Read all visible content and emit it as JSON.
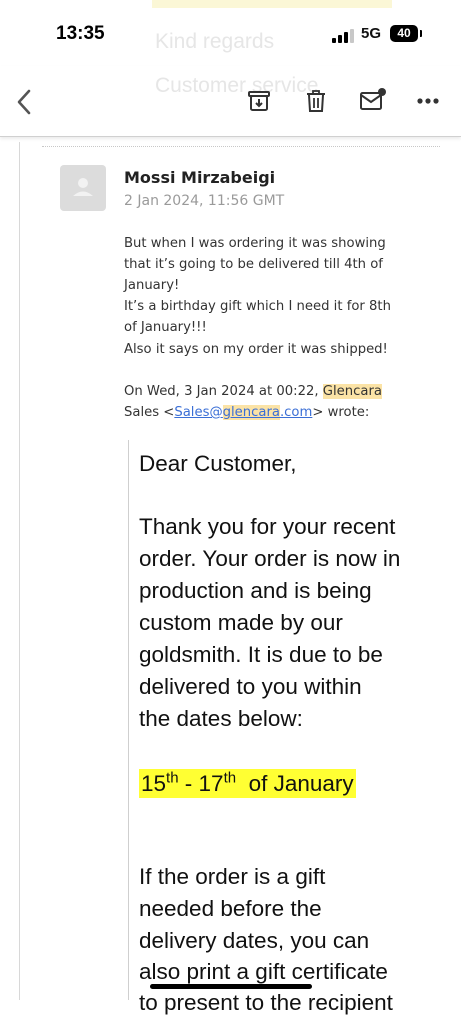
{
  "status": {
    "time": "13:35",
    "network": "5G",
    "battery": "40"
  },
  "background": {
    "line1": "Kind regards",
    "line2": "Customer service"
  },
  "toolbar": {
    "back": "back-chevron-icon",
    "archive": "archive-box-icon",
    "trash": "trash-icon",
    "unread": "mark-unread-icon",
    "more": "more-ellipsis-icon"
  },
  "message": {
    "sender": "Mossi Mirzabeigi",
    "date": "2 Jan 2024, 11:56 GMT",
    "lines": [
      "But when I was ordering it was showing",
      "that it’s going to be delivered till 4th of",
      "January!",
      "It’s a birthday gift which I need it for 8th",
      "of January!!!",
      "Also it says on my order it was shipped!"
    ],
    "reply_header": {
      "prefix": "On Wed, 3 Jan 2024 at 00:22,",
      "name_hl": "Glencara",
      "line2_prefix": "Sales <",
      "email_a": "Sales@",
      "email_hl": "glencara",
      "email_b": ".com",
      "line2_suffix": "> wrote:"
    }
  },
  "quoted": {
    "greeting": "Dear Customer,",
    "para1": [
      "Thank you for your recent",
      "order. Your order is now in",
      "production and is being",
      "custom made by our",
      "goldsmith. It is due to be",
      "delivered to you within",
      "the dates below:"
    ],
    "dates": {
      "d1": "15",
      "s1": "th",
      "mid": " - 17",
      "s2": "th",
      "tail": "  of January"
    },
    "para2": [
      "If the order is a gift",
      "needed before the",
      "delivery dates, you can",
      "also print a gift certificate",
      "to present to the recipient"
    ]
  }
}
